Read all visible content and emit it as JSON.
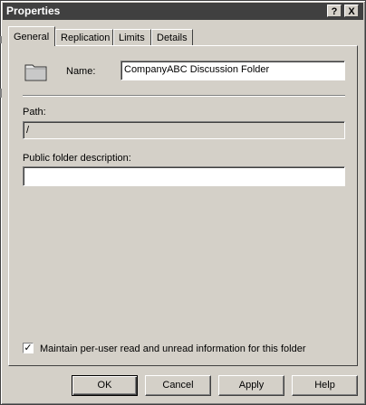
{
  "window": {
    "title": "Properties",
    "help_button": "?",
    "close_button": "X"
  },
  "tabs": [
    {
      "label": "General",
      "active": true
    },
    {
      "label": "Replication",
      "active": false
    },
    {
      "label": "Limits",
      "active": false
    },
    {
      "label": "Details",
      "active": false
    }
  ],
  "general": {
    "name_label": "Name:",
    "name_value": "CompanyABC Discussion Folder",
    "path_label": "Path:",
    "path_value": "/",
    "description_label": "Public folder description:",
    "description_value": "",
    "maintain_checkbox_label": "Maintain per-user read and unread information for this folder",
    "maintain_checked": true
  },
  "buttons": {
    "ok": "OK",
    "cancel": "Cancel",
    "apply": "Apply",
    "help": "Help"
  },
  "icons": {
    "folder": "folder-icon",
    "check": "check-icon"
  }
}
